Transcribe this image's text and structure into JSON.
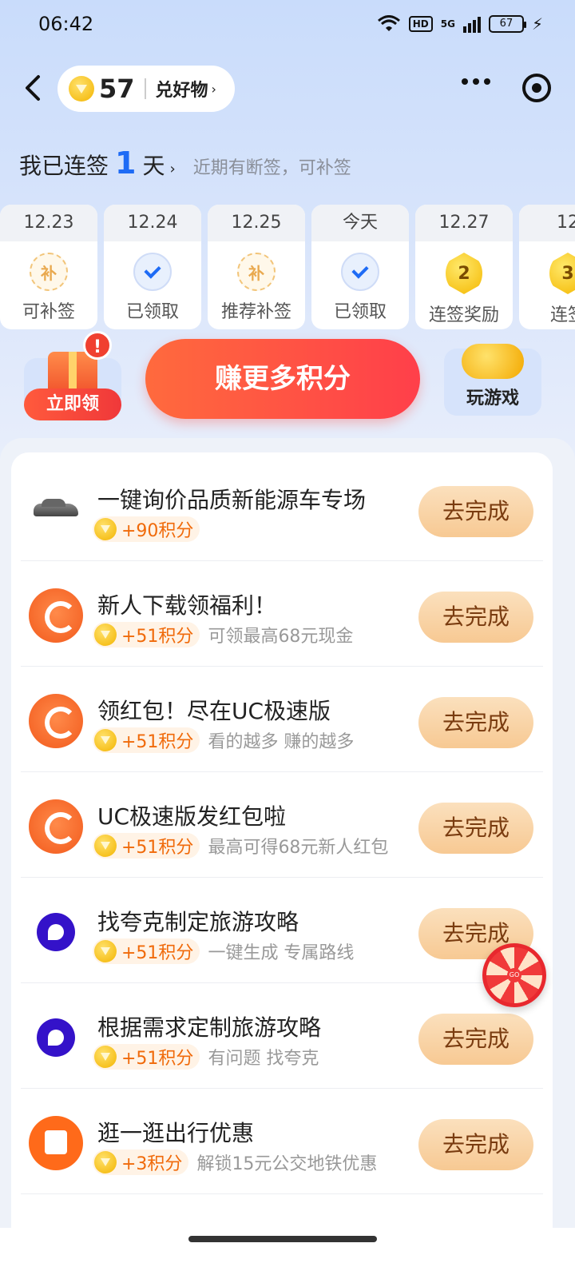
{
  "status_bar": {
    "time": "06:42",
    "network": "5G",
    "hd": "HD",
    "battery": "67"
  },
  "header": {
    "points": "57",
    "redeem_link": "兑好物",
    "redeem_arrow": "›"
  },
  "streak": {
    "prefix": "我已连签",
    "days": "1",
    "suffix": "天",
    "arrow": "›",
    "note": "近期有断签，可补签"
  },
  "days": [
    {
      "date": "12.23",
      "icon": "bu-icon",
      "icon_text": "补",
      "label": "可补签"
    },
    {
      "date": "12.24",
      "icon": "check-icon",
      "icon_text": "",
      "label": "已领取"
    },
    {
      "date": "12.25",
      "icon": "bu-icon",
      "icon_text": "补",
      "label": "推荐补签"
    },
    {
      "date": "今天",
      "icon": "check-icon",
      "icon_text": "",
      "label": "已领取"
    },
    {
      "date": "12.27",
      "icon": "medal-icon",
      "icon_text": "2",
      "label": "连签奖励"
    },
    {
      "date": "12",
      "icon": "medal-icon",
      "icon_text": "3",
      "label": "连签"
    }
  ],
  "actions": {
    "gift_badge": "!",
    "gift_label": "立即领",
    "earn_label": "赚更多积分",
    "game_label": "玩游戏"
  },
  "tasks": [
    {
      "icon": "car-icon",
      "title": "一键询价品质新能源车专场",
      "reward": "+90积分",
      "note": "",
      "button": "去完成"
    },
    {
      "icon": "uc-icon",
      "title": "新人下载领福利！",
      "reward": "+51积分",
      "note": "可领最高68元现金",
      "button": "去完成"
    },
    {
      "icon": "uc-icon",
      "title": "领红包！尽在UC极速版",
      "reward": "+51积分",
      "note": "看的越多 赚的越多",
      "button": "去完成"
    },
    {
      "icon": "uc-icon",
      "title": "UC极速版发红包啦",
      "reward": "+51积分",
      "note": "最高可得68元新人红包",
      "button": "去完成"
    },
    {
      "icon": "kuake-icon",
      "title": "找夸克制定旅游攻略",
      "reward": "+51积分",
      "note": "一键生成 专属路线",
      "button": "去完成"
    },
    {
      "icon": "kuake-icon",
      "title": "根据需求定制旅游攻略",
      "reward": "+51积分",
      "note": "有问题 找夸克",
      "button": "去完成"
    },
    {
      "icon": "bag-icon",
      "title": "逛一逛出行优惠",
      "reward": "+3积分",
      "note": "解锁15元公交地铁优惠",
      "button": "去完成"
    }
  ],
  "wheel_label": "GO"
}
